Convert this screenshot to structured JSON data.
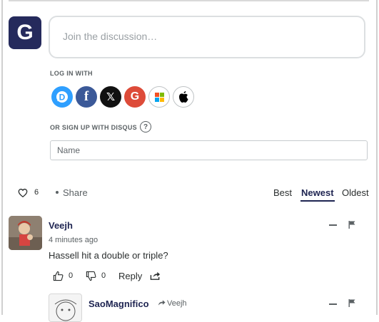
{
  "compose": {
    "avatar_letter": "G",
    "placeholder": "Join the discussion…"
  },
  "login": {
    "label": "LOG IN WITH",
    "providers": [
      "disqus",
      "facebook",
      "x",
      "google",
      "microsoft",
      "apple"
    ]
  },
  "signup": {
    "label": "OR SIGN UP WITH DISQUS",
    "help": "?",
    "name_placeholder": "Name"
  },
  "toolbar": {
    "likes": "6",
    "share": "Share",
    "sort_options": [
      "Best",
      "Newest",
      "Oldest"
    ],
    "active_sort": "Newest"
  },
  "comments": [
    {
      "author": "Veejh",
      "time": "4 minutes ago",
      "text": "Hassell hit a double or triple?",
      "upvotes": "0",
      "downvotes": "0",
      "reply_label": "Reply"
    },
    {
      "author": "SaoMagnifico",
      "reply_to": "Veejh"
    }
  ],
  "colors": {
    "brand_navy": "#1e2451",
    "avatar_bg": "#252a5c",
    "disqus": "#2e9fff",
    "facebook": "#3b5998",
    "google": "#dd4b39"
  }
}
